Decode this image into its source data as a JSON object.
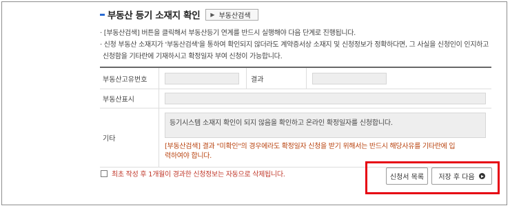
{
  "section": {
    "title": "부동산 등기 소재지 확인",
    "search_button": "부동산검색"
  },
  "notes": [
    "· [부동산검색] 버튼을 클릭해서 부동산등기 연계를 반드시 실행해야 다음 단계로 진행됩니다.",
    "· 신청 부동산 소재지가 '부동산검색'을 통하여 확인되지 않더라도 계약증서상 소재지 및 신청정보가 정확하다면, 그 사실을 신청인이 인지하고",
    "  신청함을 기타란에 기재하시고 확정일자 부여 신청이 가능합니다."
  ],
  "form": {
    "unique_no_label": "부동산고유번호",
    "result_label": "결과",
    "display_label": "부동산표시",
    "etc_label": "기타",
    "etc_text": "등기시스템 소재지 확인이 되지 않음을 확인하고 온라인 확정일자를 신청합니다.",
    "etc_warning_1": "[부동산검색] 결과 \"미확인\"의 경우에라도 확정일자 신청을 받기 위해서는 반드시 해당사유를 기타란에 입",
    "etc_warning_2": "력하여야 합니다."
  },
  "bottom_note": "최초 작성 후 1개월이 경과한 신청정보는 자동으로 삭제됩니다.",
  "buttons": {
    "list": "신청서 목록",
    "save_next": "저장 후 다음"
  },
  "colors": {
    "highlight": "#e60012",
    "warning_text": "#b8420e",
    "title_mark": "#2a6bd3"
  }
}
